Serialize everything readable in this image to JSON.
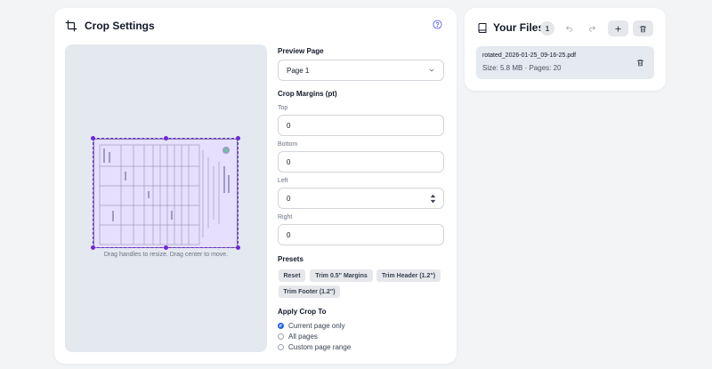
{
  "crop_panel": {
    "title": "Crop Settings",
    "hint": "Drag handles to resize. Drag center to move.",
    "preview_page": {
      "label": "Preview Page",
      "value": "Page 1"
    },
    "margins": {
      "label": "Crop Margins (pt)",
      "top": {
        "label": "Top",
        "value": "0"
      },
      "bottom": {
        "label": "Bottom",
        "value": "0"
      },
      "left": {
        "label": "Left",
        "value": "0"
      },
      "right": {
        "label": "Right",
        "value": "0"
      }
    },
    "presets": {
      "label": "Presets",
      "items": [
        "Reset",
        "Trim 0.5\" Margins",
        "Trim Header (1.2\")",
        "Trim Footer (1.2\")"
      ]
    },
    "apply": {
      "label": "Apply Crop To",
      "options": [
        "Current page only",
        "All pages",
        "Custom page range"
      ],
      "selected": "Current page only"
    }
  },
  "files_panel": {
    "title": "Your Files",
    "count": "1",
    "file": {
      "name": "rotated_2026-01-25_09-16-25.pdf",
      "meta": "Size: 5.8 MB · Pages: 20"
    }
  },
  "colors": {
    "accent": "#6d28d9",
    "radio": "#2563eb",
    "help": "#6366f1"
  }
}
